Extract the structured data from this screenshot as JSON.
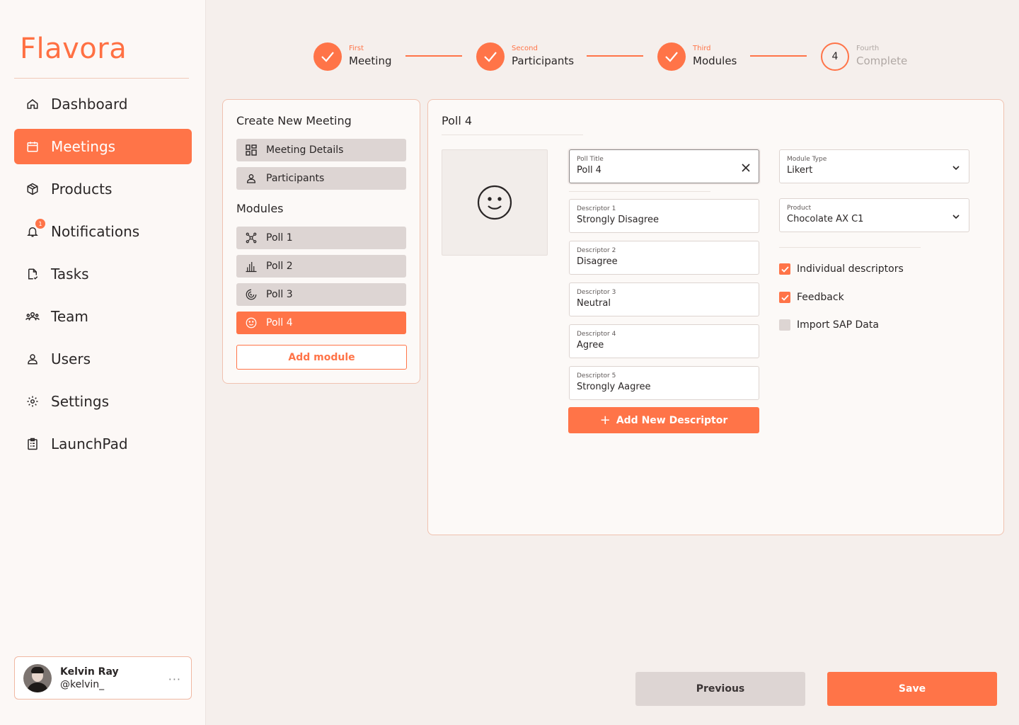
{
  "app": {
    "name": "Flavora",
    "accent": "#ff7448"
  },
  "sidebar": {
    "items": [
      {
        "label": "Dashboard",
        "icon": "home-icon"
      },
      {
        "label": "Meetings",
        "icon": "calendar-icon",
        "active": true
      },
      {
        "label": "Products",
        "icon": "box-icon"
      },
      {
        "label": "Notifications",
        "icon": "bell-icon",
        "badge": "1"
      },
      {
        "label": "Tasks",
        "icon": "document-check-icon"
      },
      {
        "label": "Team",
        "icon": "team-icon"
      },
      {
        "label": "Users",
        "icon": "user-icon"
      },
      {
        "label": "Settings",
        "icon": "gear-icon"
      },
      {
        "label": "LaunchPad",
        "icon": "clipboard-icon"
      }
    ],
    "user": {
      "name": "Kelvin Ray",
      "handle": "@kelvin_",
      "more": "···"
    }
  },
  "stepper": {
    "steps": [
      {
        "small": "First",
        "label": "Meeting",
        "status": "done"
      },
      {
        "small": "Second",
        "label": "Participants",
        "status": "done"
      },
      {
        "small": "Third",
        "label": "Modules",
        "status": "done"
      },
      {
        "small": "Fourth",
        "label": "Complete",
        "status": "todo",
        "number": "4"
      }
    ]
  },
  "meeting_panel": {
    "title": "Create New Meeting",
    "details_label": "Meeting Details",
    "participants_label": "Participants",
    "modules_heading": "Modules",
    "modules": [
      {
        "label": "Poll 1",
        "icon": "network-icon"
      },
      {
        "label": "Poll 2",
        "icon": "bar-chart-icon"
      },
      {
        "label": "Poll 3",
        "icon": "spiral-icon"
      },
      {
        "label": "Poll 4",
        "icon": "smiley-icon",
        "active": true
      }
    ],
    "add_module_label": "Add module"
  },
  "poll_panel": {
    "title": "Poll 4",
    "poll_title": {
      "label": "Poll Title",
      "value": "Poll 4"
    },
    "descriptors": [
      {
        "label": "Descriptor 1",
        "value": "Strongly Disagree"
      },
      {
        "label": "Descriptor 2",
        "value": "Disagree"
      },
      {
        "label": "Descriptor 3",
        "value": "Neutral"
      },
      {
        "label": "Descriptor 4",
        "value": "Agree"
      },
      {
        "label": "Descriptor 5",
        "value": "Strongly Aagree"
      }
    ],
    "add_descriptor_label": "Add New Descriptor",
    "module_type": {
      "label": "Module Type",
      "value": "Likert"
    },
    "product": {
      "label": "Product",
      "value": "Chocolate AX C1"
    },
    "options": [
      {
        "label": "Individual descriptors",
        "checked": true
      },
      {
        "label": "Feedback",
        "checked": true
      },
      {
        "label": "Import SAP Data",
        "checked": false
      }
    ]
  },
  "footer": {
    "previous_label": "Previous",
    "save_label": "Save"
  }
}
